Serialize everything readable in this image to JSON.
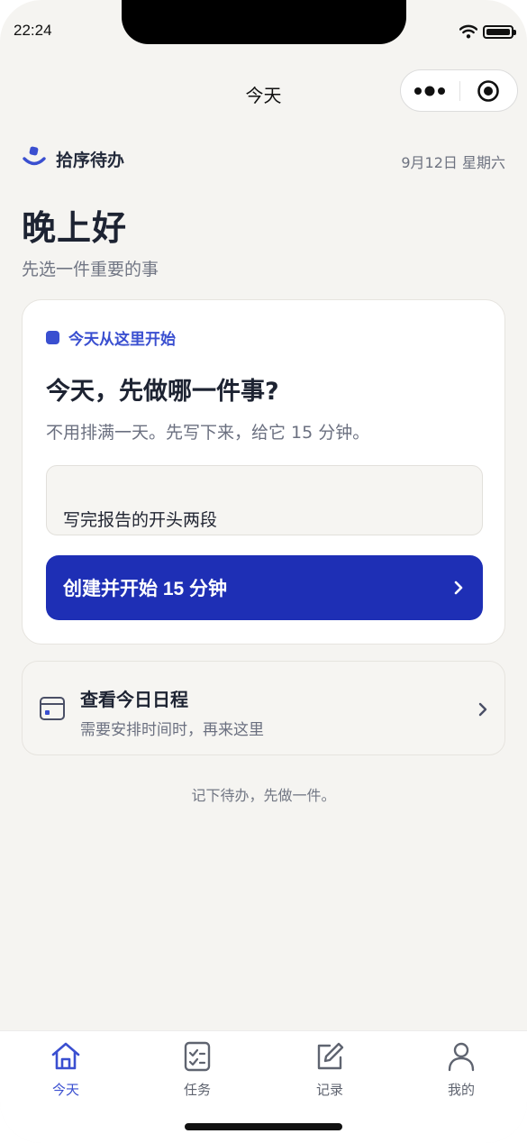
{
  "status_bar": {
    "time": "22:24"
  },
  "nav": {
    "title": "今天"
  },
  "brand": {
    "name": "拾序待办"
  },
  "date": "9月12日 星期六",
  "greeting": {
    "title": "晚上好",
    "subtitle": "先选一件重要的事"
  },
  "focus_card": {
    "hint": "今天从这里开始",
    "title": "今天，先做哪一件事?",
    "description": "不用排满一天。先写下来，给它 15 分钟。",
    "task_input_value": "写完报告的开头两段",
    "button_label": "创建并开始 15 分钟"
  },
  "schedule": {
    "title": "查看今日日程",
    "subtitle": "需要安排时间时，再来这里"
  },
  "footer_note": "记下待办，先做一件。",
  "tabbar": {
    "active": "today",
    "items": [
      {
        "id": "today",
        "label": "今天",
        "icon": "home-icon"
      },
      {
        "id": "tasks",
        "label": "任务",
        "icon": "checklist-icon"
      },
      {
        "id": "records",
        "label": "记录",
        "icon": "edit-icon"
      },
      {
        "id": "me",
        "label": "我的",
        "icon": "person-icon"
      }
    ]
  },
  "colors": {
    "accent": "#3a4fd0",
    "primary_button": "#1e2fb5",
    "background": "#f5f4f1"
  }
}
